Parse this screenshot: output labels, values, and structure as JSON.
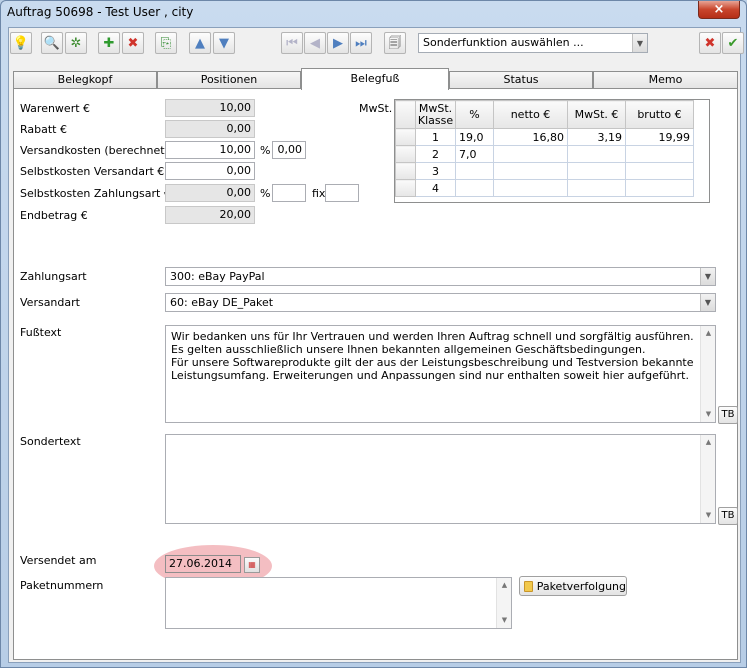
{
  "window": {
    "title": "Auftrag 50698 - Test User , city",
    "close_label": "×"
  },
  "toolbar": {
    "special_function": {
      "value": "Sonderfunktion auswählen ..."
    }
  },
  "tabs": [
    {
      "label": "Belegkopf"
    },
    {
      "label": "Positionen"
    },
    {
      "label": "Belegfuß"
    },
    {
      "label": "Status"
    },
    {
      "label": "Memo"
    }
  ],
  "active_tab": "Belegfuß",
  "totals": {
    "warenwert": {
      "label": "Warenwert €",
      "value": "10,00"
    },
    "rabatt": {
      "label": "Rabatt €",
      "value": "0,00"
    },
    "versandkosten": {
      "label": "Versandkosten (berechnet) €",
      "value": "10,00",
      "pct_label": "%",
      "pct_value": "0,00"
    },
    "selbstkosten_versandart": {
      "label": "Selbstkosten Versandart €",
      "value": "0,00"
    },
    "selbstkosten_zahlungsart": {
      "label": "Selbstkosten Zahlungsart €",
      "value": "0,00",
      "pct_label": "%",
      "pct_value": "",
      "fix_label": "fix",
      "fix_value": ""
    },
    "endbetrag": {
      "label": "Endbetrag €",
      "value": "20,00"
    }
  },
  "mwst": {
    "label": "MwSt.",
    "columns": [
      "MwSt. Klasse",
      "%",
      "netto €",
      "MwSt. €",
      "brutto €"
    ],
    "rows": [
      {
        "klasse": "1",
        "pct": "19,0",
        "netto": "16,80",
        "mwst": "3,19",
        "brutto": "19,99"
      },
      {
        "klasse": "2",
        "pct": "7,0",
        "netto": "",
        "mwst": "",
        "brutto": ""
      },
      {
        "klasse": "3",
        "pct": "",
        "netto": "",
        "mwst": "",
        "brutto": ""
      },
      {
        "klasse": "4",
        "pct": "",
        "netto": "",
        "mwst": "",
        "brutto": ""
      }
    ]
  },
  "zahlungsart": {
    "label": "Zahlungsart",
    "value": "300: eBay PayPal"
  },
  "versandart": {
    "label": "Versandart",
    "value": "60: eBay DE_Paket"
  },
  "fusstext": {
    "label": "Fußtext",
    "lines": [
      "Wir bedanken uns für Ihr Vertrauen und werden Ihren Auftrag schnell und sorgfältig ausführen.",
      "Es gelten ausschließlich unsere Ihnen bekannten allgemeinen Geschäftsbedingungen.",
      "Für unsere Softwareprodukte gilt der aus der Leistungsbeschreibung und Testversion bekannte",
      "Leistungsumfang. Erweiterungen und Anpassungen sind nur enthalten soweit hier aufgeführt."
    ],
    "tb_label": "TB"
  },
  "sondertext": {
    "label": "Sondertext",
    "value": "",
    "tb_label": "TB"
  },
  "versendet_am": {
    "label": "Versendet am",
    "value": "27.06.2014"
  },
  "paketnummern": {
    "label": "Paketnummern",
    "value": "",
    "tracking_button": "Paketverfolgung"
  }
}
